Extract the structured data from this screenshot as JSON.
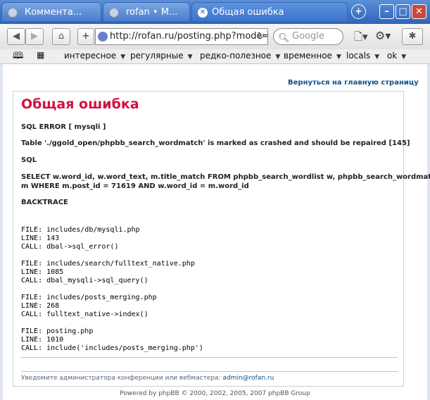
{
  "tabs": [
    {
      "label": "Коммента..."
    },
    {
      "label": "rofan • М..."
    },
    {
      "label": "Общая ошибка"
    }
  ],
  "window_controls": {
    "new_tab": "+",
    "minimize": "–",
    "maximize": "□",
    "close": "✕"
  },
  "nav": {
    "url": "http://rofan.ru/posting.php?mode=re",
    "search_placeholder": "Google"
  },
  "bookmarks": [
    {
      "label": "интересное"
    },
    {
      "label": "регулярные"
    },
    {
      "label": "редко-полезное"
    },
    {
      "label": "временное"
    },
    {
      "label": "locals"
    },
    {
      "label": "ok"
    }
  ],
  "page": {
    "back_link": "Вернуться на главную страницу",
    "title": "Общая ошибка",
    "sql_error": "SQL ERROR [ mysqli ]",
    "table_msg": "Table './ggold_open/phpbb_search_wordmatch' is marked as crashed and should be repaired [145]",
    "sql_label": "SQL",
    "sql_line1": "SELECT w.word_id, w.word_text, m.title_match FROM phpbb_search_wordlist w, phpbb_search_wordmatch",
    "sql_line2": "m WHERE m.post_id = 71619 AND w.word_id = m.word_id",
    "backtrace_label": "BACKTRACE",
    "backtrace": [
      {
        "file": "FILE: includes/db/mysqli.php",
        "line": "LINE: 143",
        "call": "CALL: dbal->sql_error()"
      },
      {
        "file": "FILE: includes/search/fulltext_native.php",
        "line": "LINE: 1085",
        "call": "CALL: dbal_mysqli->sql_query()"
      },
      {
        "file": "FILE: includes/posts_merging.php",
        "line": "LINE: 268",
        "call": "CALL: fulltext_native->index()"
      },
      {
        "file": "FILE: posting.php",
        "line": "LINE: 1010",
        "call": "CALL: include('includes/posts_merging.php')"
      }
    ],
    "notice": "Уведомите администратора конференции или вебмастера:",
    "notice_email": "admin@rofan.ru",
    "powered": "Powered by phpBB © 2000, 2002, 2005, 2007 phpBB Group"
  }
}
